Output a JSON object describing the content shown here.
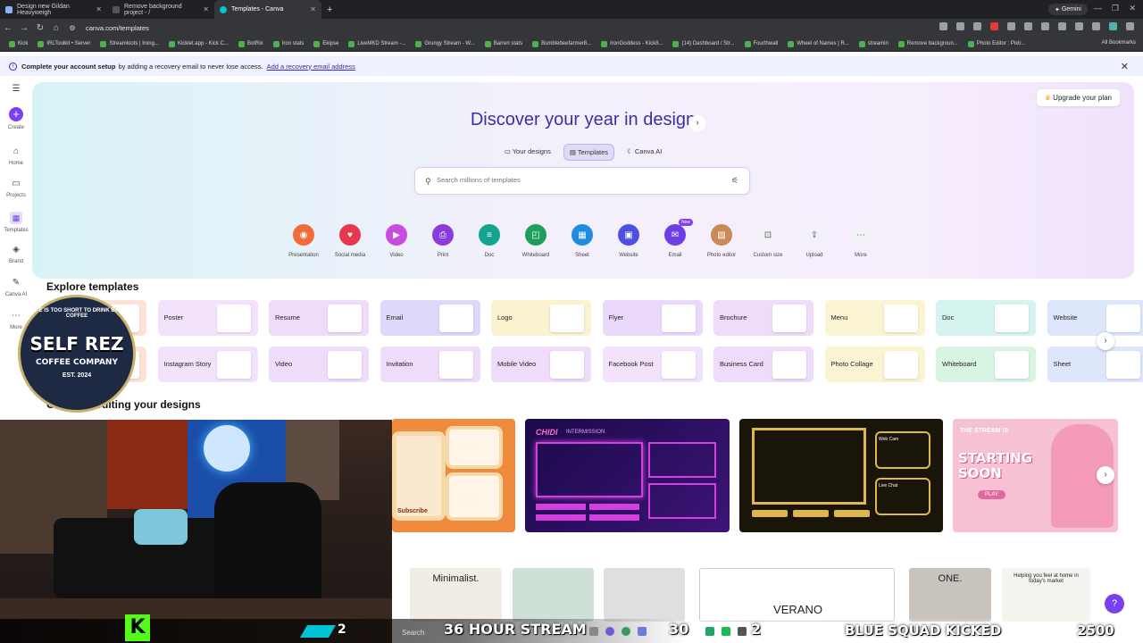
{
  "browser": {
    "tabs": [
      {
        "title": "Design new Gildan Heavyweigh",
        "active": false
      },
      {
        "title": "Remove background project - /",
        "active": false
      },
      {
        "title": "Templates - Canva",
        "active": true
      }
    ],
    "gemini_label": "Gemini",
    "url": "canva.com/templates",
    "bookmarks": [
      "Kick",
      "IRLToolkit • Server",
      "Streamloots | Irong...",
      "Kicklet.app - Kick C...",
      "BotRix",
      "Iron stats",
      "Ekipse",
      "LiveMKD Stream -...",
      "Grungy Stream - W...",
      "Barren stats",
      "Bumblebeefarmer8...",
      "IronGoddess - Kick8...",
      "(14) Dashboard / Str...",
      "Fourthwall",
      "Wheel of Names | R...",
      "streamin",
      "Remove backgroun...",
      "Photo Editor : Pixlr..."
    ],
    "all_bookmarks": "All Bookmarks"
  },
  "notice": {
    "bold": "Complete your account setup",
    "text": "by adding a recovery email to never lose access.",
    "link": "Add a recovery email address"
  },
  "rail": [
    {
      "label": "",
      "icon": "menu-icon"
    },
    {
      "label": "Create",
      "icon": "plus-icon"
    },
    {
      "label": "Home",
      "icon": "home-icon"
    },
    {
      "label": "Projects",
      "icon": "folder-icon"
    },
    {
      "label": "Templates",
      "icon": "templates-icon"
    },
    {
      "label": "Brand",
      "icon": "brand-icon"
    },
    {
      "label": "Canva AI",
      "icon": "canva-ai-icon"
    },
    {
      "label": "More",
      "icon": "more-icon"
    }
  ],
  "hero": {
    "upgrade": "Upgrade your plan",
    "title": "Discover your year in design",
    "pills": [
      "Your designs",
      "Templates",
      "Canva AI"
    ],
    "search_placeholder": "Search millions of templates"
  },
  "categories": [
    {
      "label": "Presentation",
      "color": "#f26b3a"
    },
    {
      "label": "Social media",
      "color": "#e8384f"
    },
    {
      "label": "Video",
      "color": "#c94ce0"
    },
    {
      "label": "Print",
      "color": "#8a3bdc"
    },
    {
      "label": "Doc",
      "color": "#13a38f"
    },
    {
      "label": "Whiteboard",
      "color": "#1ea05a"
    },
    {
      "label": "Sheet",
      "color": "#1f8ce0"
    },
    {
      "label": "Website",
      "color": "#4d4fe0"
    },
    {
      "label": "Email",
      "color": "#6d3ee6",
      "badge": "New"
    },
    {
      "label": "Photo editor",
      "color": "#c98a55"
    },
    {
      "label": "Custom size",
      "color": "#ffffff"
    },
    {
      "label": "Upload",
      "color": "#ffffff"
    },
    {
      "label": "More",
      "color": "#ffffff"
    }
  ],
  "explore": {
    "title": "Explore templates",
    "row1": [
      {
        "label": "",
        "color": "#fde2d6"
      },
      {
        "label": "Poster",
        "color": "#f3e2fb"
      },
      {
        "label": "Resume",
        "color": "#eedcfa"
      },
      {
        "label": "Email",
        "color": "#dcd9fb"
      },
      {
        "label": "Logo",
        "color": "#fbf2cf"
      },
      {
        "label": "Flyer",
        "color": "#ead9fb"
      },
      {
        "label": "Brochure",
        "color": "#eedcfa"
      },
      {
        "label": "Menu",
        "color": "#fbf4d2"
      },
      {
        "label": "Doc",
        "color": "#d6f4ef"
      },
      {
        "label": "Website",
        "color": "#dde6fb"
      }
    ],
    "row2": [
      {
        "label": "",
        "color": "#fde2d6"
      },
      {
        "label": "Instagram Story",
        "color": "#f3e2fb"
      },
      {
        "label": "Video",
        "color": "#eedcfa"
      },
      {
        "label": "Invitation",
        "color": "#eedcfa"
      },
      {
        "label": "Mobile Video",
        "color": "#eedcfa"
      },
      {
        "label": "Facebook Post",
        "color": "#f3e2fb"
      },
      {
        "label": "Business Card",
        "color": "#eedcfa"
      },
      {
        "label": "Photo Collage",
        "color": "#fbf4d2"
      },
      {
        "label": "Whiteboard",
        "color": "#d8f4e2"
      },
      {
        "label": "Sheet",
        "color": "#dde6fb"
      }
    ]
  },
  "recent": {
    "title": "Continue editing your designs",
    "cards": [
      {
        "label": "Subscribe",
        "color": "#f08a3c"
      },
      {
        "label": "CHIDI",
        "sublabel": "INTERMISSION",
        "color": "#2a0f5c"
      },
      {
        "label": "Web Cam",
        "sublabel": "Live Chat",
        "color": "#1e1a10"
      },
      {
        "label": "THE STREAM IS",
        "sublabel": "STARTING SOON",
        "extra": "PLAY",
        "color": "#f7c1d4"
      }
    ]
  },
  "bottom_cards": [
    {
      "label": "Minimalist.",
      "color": "#f1ece4"
    },
    {
      "label": "",
      "color": "#cfe0d6"
    },
    {
      "label": "",
      "color": "#dfdfdf"
    },
    {
      "label": "VERANO",
      "color": "#ffffff"
    },
    {
      "label": "ONE.",
      "color": "#c8c3bd"
    },
    {
      "label": "Helping you feel at home in today's market",
      "color": "#f4f4ee"
    }
  ],
  "overlay": {
    "logo_arc": "LIFE IS TOO SHORT TO DRINK BAD COFFEE",
    "logo_main": "SELF REZ",
    "logo_sub": "COFFEE COMPANY",
    "logo_est": "EST. 2024",
    "left_count": "2",
    "search_label": "Search",
    "stream_title": "36 HOUR STREAM",
    "count_30": "30",
    "count_2": "2",
    "ticker": "BLUE SQUAD KICKED",
    "score": "2500"
  }
}
